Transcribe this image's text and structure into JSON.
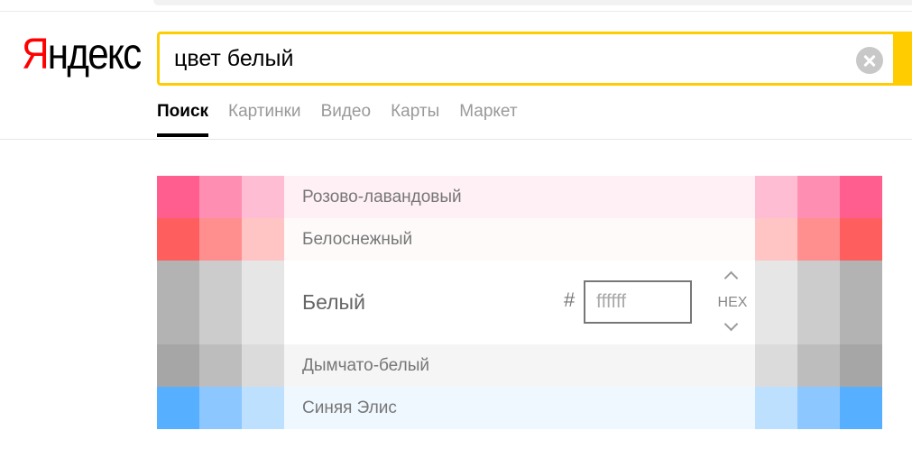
{
  "logo": {
    "first": "Я",
    "rest": "ндекс"
  },
  "search": {
    "value": "цвет белый"
  },
  "nav": [
    {
      "label": "Поиск",
      "active": true
    },
    {
      "label": "Картинки",
      "active": false
    },
    {
      "label": "Видео",
      "active": false
    },
    {
      "label": "Карты",
      "active": false
    },
    {
      "label": "Маркет",
      "active": false
    }
  ],
  "colors": {
    "accent": "#ffcc00",
    "logo_red": "#ff0000"
  },
  "palette": {
    "rows": [
      {
        "name": "Розово-лавандовый",
        "center_bg": "#fff0f5",
        "swatches": [
          "#ff5e8f",
          "#ff8fb2",
          "#ffbdd4",
          "#ffbdd4",
          "#ff8fb2",
          "#ff5e8f"
        ]
      },
      {
        "name": "Белоснежный",
        "center_bg": "#fffafa",
        "swatches": [
          "#ff5e5e",
          "#ff8f8f",
          "#ffc4c4",
          "#ffc4c4",
          "#ff8f8f",
          "#ff5e5e"
        ]
      },
      {
        "name": "Белый",
        "center_bg": "#ffffff",
        "selected": true,
        "swatches": [
          "#b3b3b3",
          "#cccccc",
          "#e6e6e6",
          "#e6e6e6",
          "#cccccc",
          "#b3b3b3"
        ]
      },
      {
        "name": "Дымчато-белый",
        "center_bg": "#f5f5f5",
        "swatches": [
          "#a6a6a6",
          "#bdbdbd",
          "#dbdbdb",
          "#dbdbdb",
          "#bdbdbd",
          "#a6a6a6"
        ]
      },
      {
        "name": "Синяя Элис",
        "center_bg": "#f0f8ff",
        "swatches": [
          "#57b0ff",
          "#8cc7ff",
          "#bde0ff",
          "#bde0ff",
          "#8cc7ff",
          "#57b0ff"
        ]
      }
    ],
    "hash": "#",
    "hex_value": "ffffff",
    "format_label": "HEX"
  }
}
